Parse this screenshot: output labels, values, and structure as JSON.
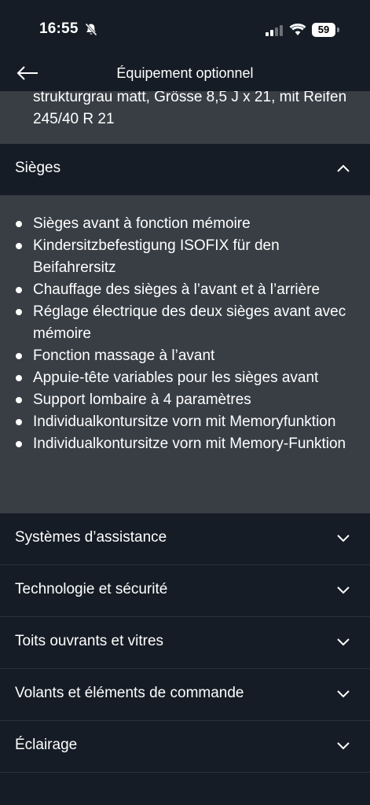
{
  "status_bar": {
    "time": "16:55",
    "battery": "59"
  },
  "nav": {
    "title": "Équipement optionnel"
  },
  "previous_section": {
    "text": "strukturgrau matt, Grösse 8,5 J x 21, mit Reifen 245/40 R 21"
  },
  "sections": [
    {
      "label": "Sièges",
      "expanded": true,
      "items": [
        "Sièges avant à fonction mémoire",
        "Kindersitzbefestigung ISOFIX für den Beifahrersitz",
        "Chauffage des sièges à l’avant et à l’arrière",
        "Réglage électrique des deux sièges avant avec mémoire",
        "Fonction massage à l’avant",
        "Appuie-tête variables pour les sièges avant",
        "Support lombaire à 4 paramètres",
        "Individualkontursitze vorn mit Memoryfunktion",
        "Individualkontursitze vorn mit Memory-Funktion"
      ]
    },
    {
      "label": "Systèmes d’assistance",
      "expanded": false
    },
    {
      "label": "Technologie et sécurité",
      "expanded": false
    },
    {
      "label": "Toits ouvrants et vitres",
      "expanded": false
    },
    {
      "label": "Volants et éléments de commande",
      "expanded": false
    },
    {
      "label": "Éclairage",
      "expanded": false
    }
  ],
  "icons": {
    "back": "arrow-left-icon",
    "collapse": "chevron-up-icon",
    "expand": "chevron-down-icon",
    "silent": "bell-slash-icon",
    "signal": "cellular-signal-icon",
    "wifi": "wifi-icon"
  },
  "colors": {
    "background": "#151c25",
    "panel": "#393e45",
    "text": "#ffffff",
    "divider": "#2a313a"
  }
}
